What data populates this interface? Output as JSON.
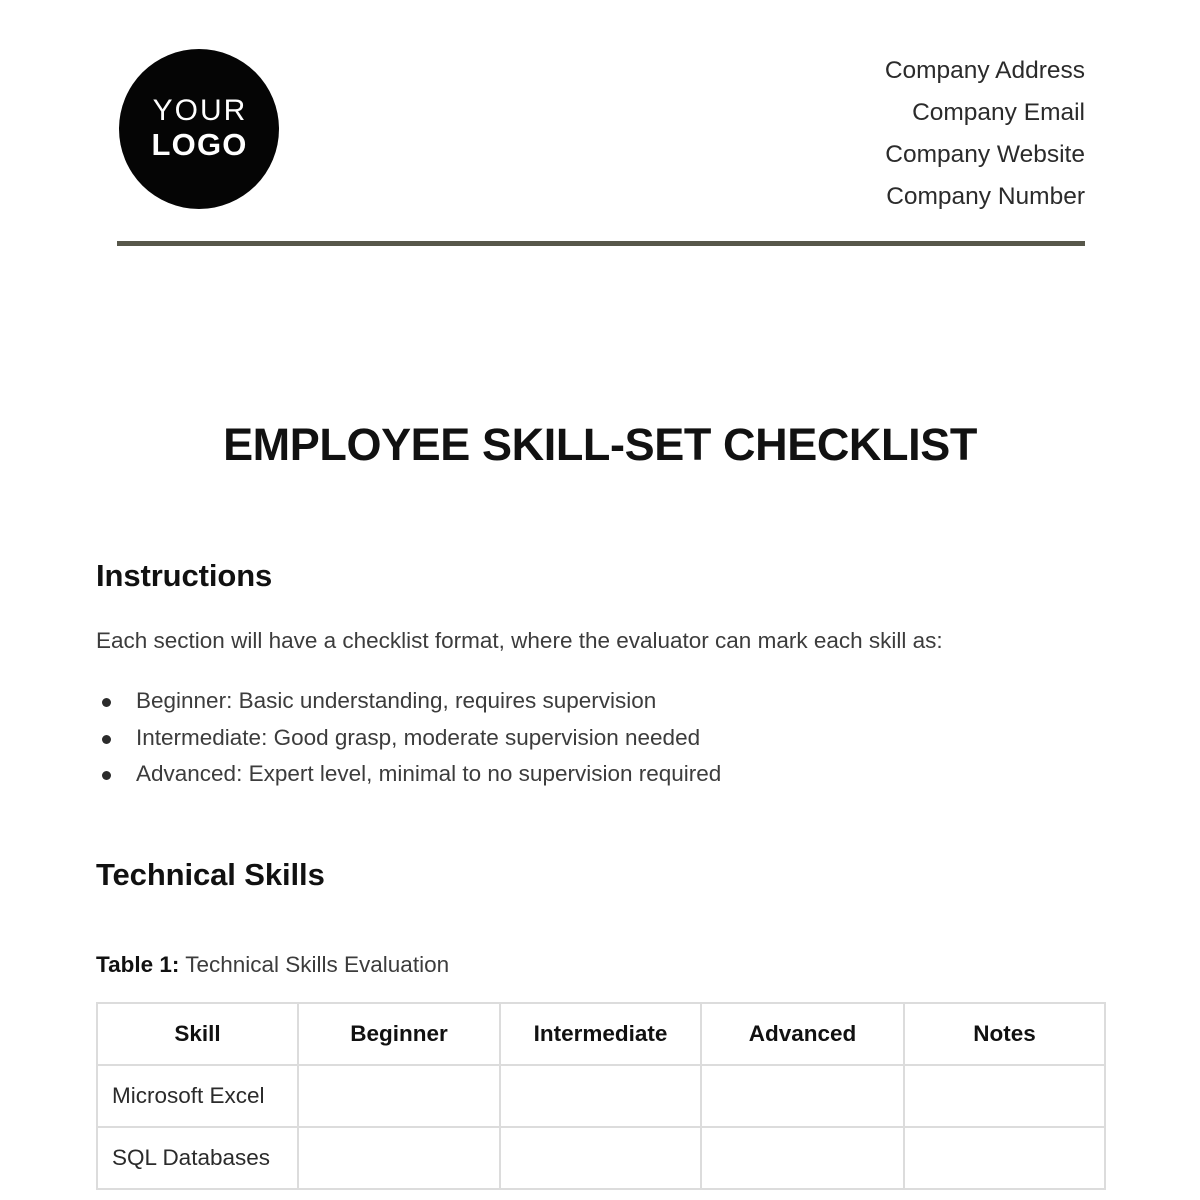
{
  "header": {
    "logo": {
      "line1": "YOUR",
      "line2": "LOGO"
    },
    "company_info": [
      "Company Address",
      "Company Email",
      "Company Website",
      "Company Number"
    ],
    "rule_color": "#57574a"
  },
  "document": {
    "title": "EMPLOYEE SKILL-SET CHECKLIST"
  },
  "instructions": {
    "heading": "Instructions",
    "paragraph": "Each section will have a checklist format, where the evaluator can mark each skill as:",
    "levels": [
      "Beginner: Basic understanding, requires supervision",
      "Intermediate: Good grasp, moderate supervision needed",
      "Advanced: Expert level, minimal to no supervision required"
    ]
  },
  "technical_skills": {
    "heading": "Technical Skills",
    "table_caption_label": "Table 1:",
    "table_caption_text": "Technical Skills Evaluation",
    "table": {
      "columns": [
        "Skill",
        "Beginner",
        "Intermediate",
        "Advanced",
        "Notes"
      ],
      "rows": [
        {
          "skill": "Microsoft Excel",
          "beginner": "",
          "intermediate": "",
          "advanced": "",
          "notes": ""
        },
        {
          "skill": "SQL Databases",
          "beginner": "",
          "intermediate": "",
          "advanced": "",
          "notes": ""
        }
      ]
    }
  }
}
